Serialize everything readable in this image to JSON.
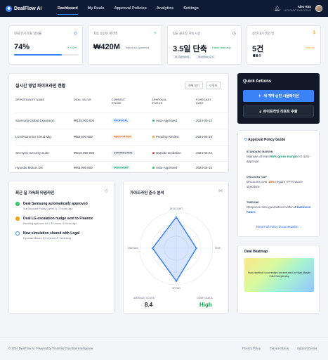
{
  "header": {
    "brand": "DealFlow AI",
    "nav": [
      "Dashboard",
      "My Deals",
      "Approval Policies",
      "Analytics",
      "Settings"
    ],
    "user_name": "Alex Kim",
    "user_role": "ACCOUNT EXECUTIVE"
  },
  "kpis": [
    {
      "label": "현재 분기 목표 달성률",
      "value": "74%",
      "delta": "↗ +12%",
      "progress": 0.74,
      "icon": "target-icon"
    },
    {
      "label": "자동 승인된 계약액",
      "value": "₩420M",
      "sub": "Total Auto-Approved",
      "icon": "lightning-icon"
    },
    {
      "label": "평균 클로징 가속 시간",
      "value": "3.5일 단축",
      "sub": "Faster than avg",
      "chips": [
        "AI Optimized",
        "Workflow v2.4"
      ],
      "icon": "clock-icon"
    },
    {
      "label": "승인 대기 중인 딜",
      "value": "5건",
      "sub": "View All",
      "icon": "dollar-icon"
    }
  ],
  "pipeline": {
    "title": "실시간 영업 파이프라인 현황",
    "btn_export": "전체 보기",
    "btn_filter": "필터",
    "columns": [
      "OPPORTUNITY NAME",
      "DEAL VALUE",
      "CURRENT STAGE",
      "APPROVAL STATUS",
      "FORECAST DATE"
    ],
    "rows": [
      {
        "name": "Samsung Global Expansion",
        "value": "₩125,000,000",
        "stage": "PROPOSAL",
        "status": "Auto-Approved",
        "date": "2024-05-12"
      },
      {
        "name": "LG Electronics Cloud Mig.",
        "value": "₩82,500,000",
        "stage": "NEGOTIATION",
        "status": "Pending Review",
        "date": "2024-05-18"
      },
      {
        "name": "SK Hynix Security Suite",
        "value": "₩210,000,000",
        "stage": "CONTRACTING",
        "status": "Outside Guideline",
        "date": "2024-05-22"
      },
      {
        "name": "Hyundai Motors DX",
        "value": "₩45,000,000",
        "stage": "DISCOVERY",
        "status": "Auto-Approved",
        "date": "2024-06-15"
      }
    ]
  },
  "quick_actions": {
    "title": "Quick Actions",
    "primary": "새 계약 승인 시뮬레이션",
    "secondary": "파이프라인 리포트 추출"
  },
  "policy_guide": {
    "title": "Approval Policy Guide",
    "blocks": [
      {
        "head": "STANDARD MARGIN",
        "pre": "Maintain at least ",
        "hl": "65% gross margin",
        "post": " for auto-approval."
      },
      {
        "head": "DISCOUNT CAP",
        "pre": "Discounts over ",
        "hl": "15%",
        "post": " require VP Finance signature."
      },
      {
        "head": "TIMELINE",
        "pre": "Response time guaranteed within ",
        "hl": "4 business hours",
        "post": "."
      }
    ],
    "link": "Read Full Policy Documentation →"
  },
  "timeline": {
    "title": "최근 딜 가속화 타임라인",
    "items": [
      {
        "title": "Deal Samsung automatically approved",
        "sub": "Via Discount Policy (Level 1). 2 hours ago"
      },
      {
        "title": "Deal LG escalation nudge sent to Finance",
        "sub": "Pending approval for > 24 hours. 5 hours ago"
      },
      {
        "title": "New simulation shared with Legal",
        "sub": "Hyundai Motors DX revised 3. Yesterday"
      }
    ]
  },
  "radar": {
    "title": "가이드라인 준수 분석",
    "axes": [
      "DISCOUNT",
      "RISK",
      "SPEED",
      "MARGIN"
    ],
    "avg_label": "AVERAGE SCORE",
    "avg_value": "8.4",
    "comp_label": "COMPLIANCE",
    "comp_value": "High"
  },
  "chart_data": {
    "type": "radar",
    "axes": [
      "DISCOUNT",
      "RISK",
      "SPEED",
      "MARGIN"
    ],
    "values": [
      0.85,
      0.55,
      0.9,
      0.65
    ],
    "range": [
      0,
      1
    ]
  },
  "heatmap": {
    "title": "Deal Heatmap",
    "text": "Your pipeline is currently concentrated in High Margin / Mid Complexity."
  },
  "footer": {
    "copyright": "© 2024 DealFlow AI. Powered by Financial Guardrail Intelligence.",
    "links": [
      "Privacy Policy",
      "Service Status",
      "Support Center"
    ]
  },
  "colors": {
    "accent": "#3b82f6",
    "navy": "#0f1b34",
    "green": "#22c55e",
    "orange": "#f59e0b",
    "red": "#ef4444"
  }
}
